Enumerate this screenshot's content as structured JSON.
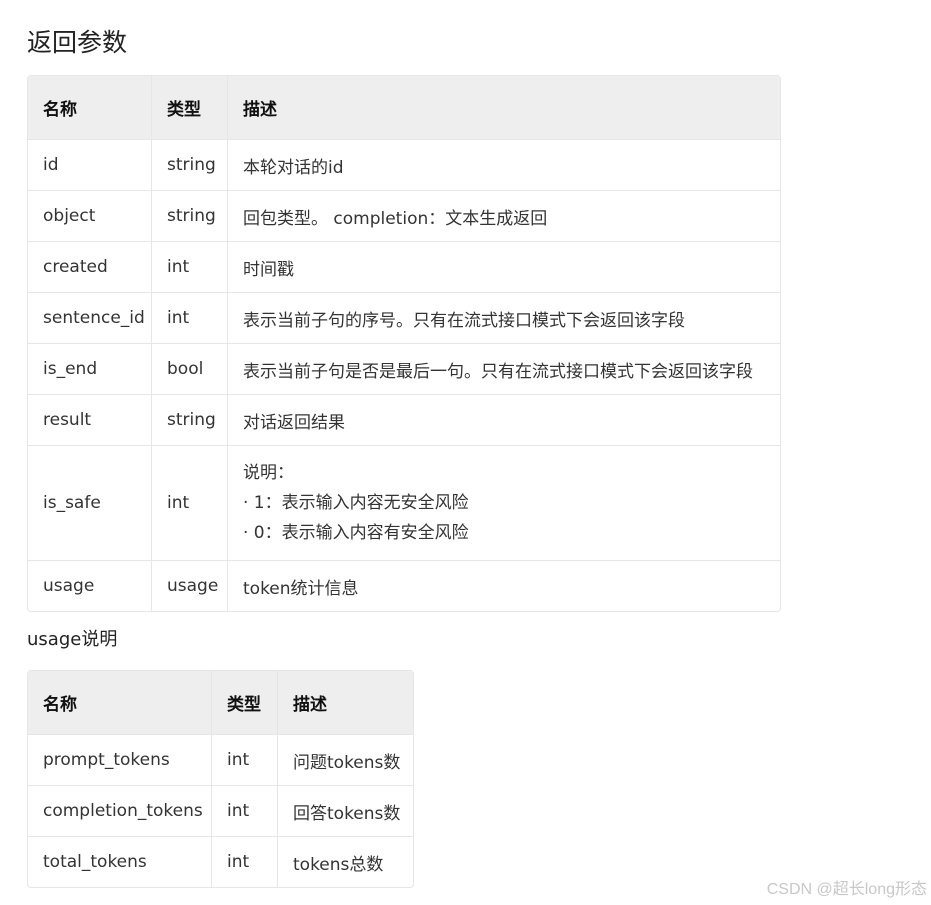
{
  "section_title": "返回参数",
  "params_table": {
    "headers": [
      "名称",
      "类型",
      "描述"
    ],
    "rows": [
      {
        "name": "id",
        "type": "string",
        "desc": [
          "本轮对话的id"
        ]
      },
      {
        "name": "object",
        "type": "string",
        "desc": [
          "回包类型。 completion：文本生成返回"
        ]
      },
      {
        "name": "created",
        "type": "int",
        "desc": [
          "时间戳"
        ]
      },
      {
        "name": "sentence_id",
        "type": "int",
        "desc": [
          "表示当前子句的序号。只有在流式接口模式下会返回该字段"
        ]
      },
      {
        "name": "is_end",
        "type": "bool",
        "desc": [
          "表示当前子句是否是最后一句。只有在流式接口模式下会返回该字段"
        ]
      },
      {
        "name": "result",
        "type": "string",
        "desc": [
          "对话返回结果"
        ]
      },
      {
        "name": "is_safe",
        "type": "int",
        "desc": [
          "说明：",
          "· 1：表示输入内容无安全风险",
          "· 0：表示输入内容有安全风险"
        ]
      },
      {
        "name": "usage",
        "type": "usage",
        "desc": [
          "token统计信息"
        ]
      }
    ]
  },
  "usage_title": "usage说明",
  "usage_table": {
    "headers": [
      "名称",
      "类型",
      "描述"
    ],
    "rows": [
      {
        "name": "prompt_tokens",
        "type": "int",
        "desc": [
          "问题tokens数"
        ]
      },
      {
        "name": "completion_tokens",
        "type": "int",
        "desc": [
          "回答tokens数"
        ]
      },
      {
        "name": "total_tokens",
        "type": "int",
        "desc": [
          "tokens总数"
        ]
      }
    ]
  },
  "watermark": "CSDN @超长long形态"
}
